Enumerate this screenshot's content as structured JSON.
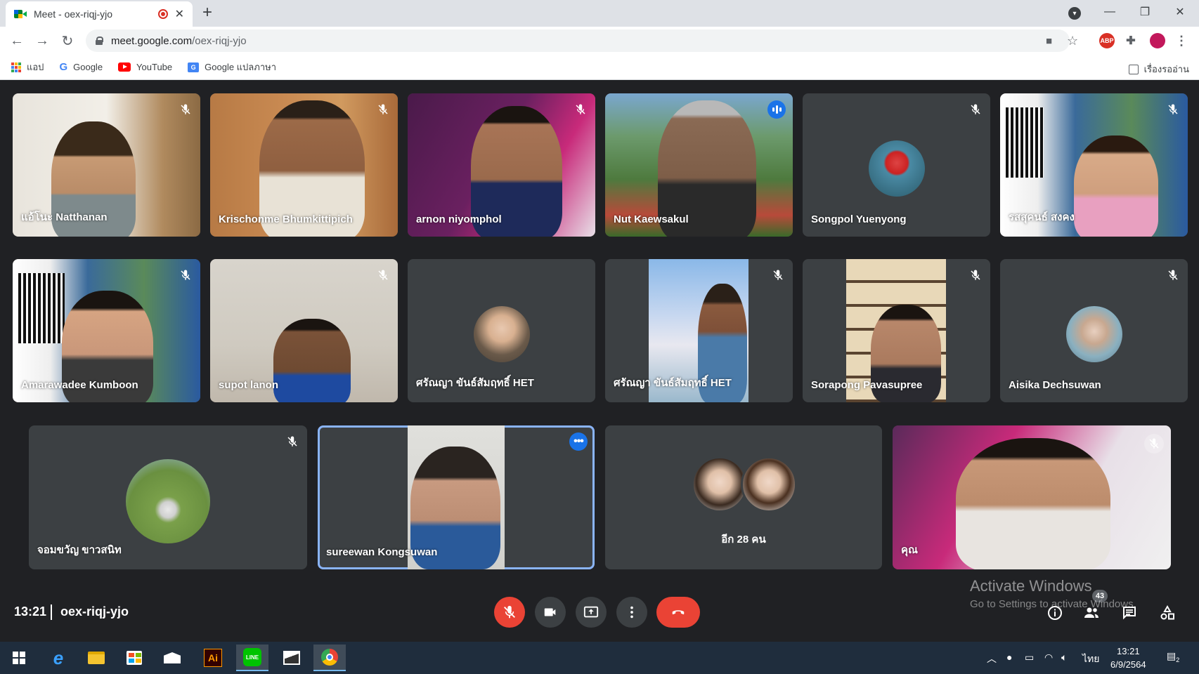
{
  "browser": {
    "tab_title": "Meet - oex-riqj-yjo",
    "tab_close": "✕",
    "new_tab": "+",
    "url_host": "meet.google.com",
    "url_path": "/oex-riqj-yjo",
    "window_controls": [
      "—",
      "❐",
      "✕"
    ]
  },
  "bookmarks": {
    "items": [
      {
        "label": "แอป",
        "icon": "apps-grid-icon"
      },
      {
        "label": "Google",
        "icon": "google-icon"
      },
      {
        "label": "YouTube",
        "icon": "youtube-icon"
      },
      {
        "label": "Google แปลภาษา",
        "icon": "google-translate-icon"
      }
    ],
    "reading_list": "เรื่องรออ่าน"
  },
  "participants": [
    {
      "name": "แอ้โนะ Natthanan",
      "muted": true
    },
    {
      "name": "Krischonme Bhumkittipich",
      "muted": true
    },
    {
      "name": "arnon niyomphol",
      "muted": true
    },
    {
      "name": "Nut Kaewsakul",
      "muted": false,
      "speaking": true
    },
    {
      "name": "Songpol Yuenyong",
      "muted": true
    },
    {
      "name": "รสสุคนธ์ สงคง",
      "muted": true
    },
    {
      "name": "Amarawadee Kumboon",
      "muted": true
    },
    {
      "name": "supot lanon",
      "muted": true
    },
    {
      "name": "ศรัณญา ขันธ์สัมฤทธิ์ HET",
      "muted": false
    },
    {
      "name": "ศรัณญา ขันธ์สัมฤทธิ์ HET",
      "muted": true
    },
    {
      "name": "Sorapong Pavasupree",
      "muted": true
    },
    {
      "name": "Aisika Dechsuwan",
      "muted": true
    },
    {
      "name": "จอมขวัญ ขาวสนิท",
      "muted": true
    },
    {
      "name": "sureewan Kongsuwan",
      "muted": false,
      "pinned": true
    },
    {
      "name": "อีก 28 คน",
      "muted": false
    },
    {
      "name": "คุณ",
      "muted": true
    }
  ],
  "meeting": {
    "time": "13:21",
    "code": "oex-riqj-yjo",
    "participant_count": "43"
  },
  "watermark": {
    "line1": "Activate Windows",
    "line2": "Go to Settings to activate Windows."
  },
  "taskbar": {
    "ime": "ไทย",
    "clock_time": "13:21",
    "clock_date": "6/9/2564",
    "notifications": "2"
  },
  "colors": {
    "meet_bg": "#202124",
    "tile_bg": "#3c4043",
    "accent": "#1a73e8",
    "danger": "#ea4335"
  }
}
